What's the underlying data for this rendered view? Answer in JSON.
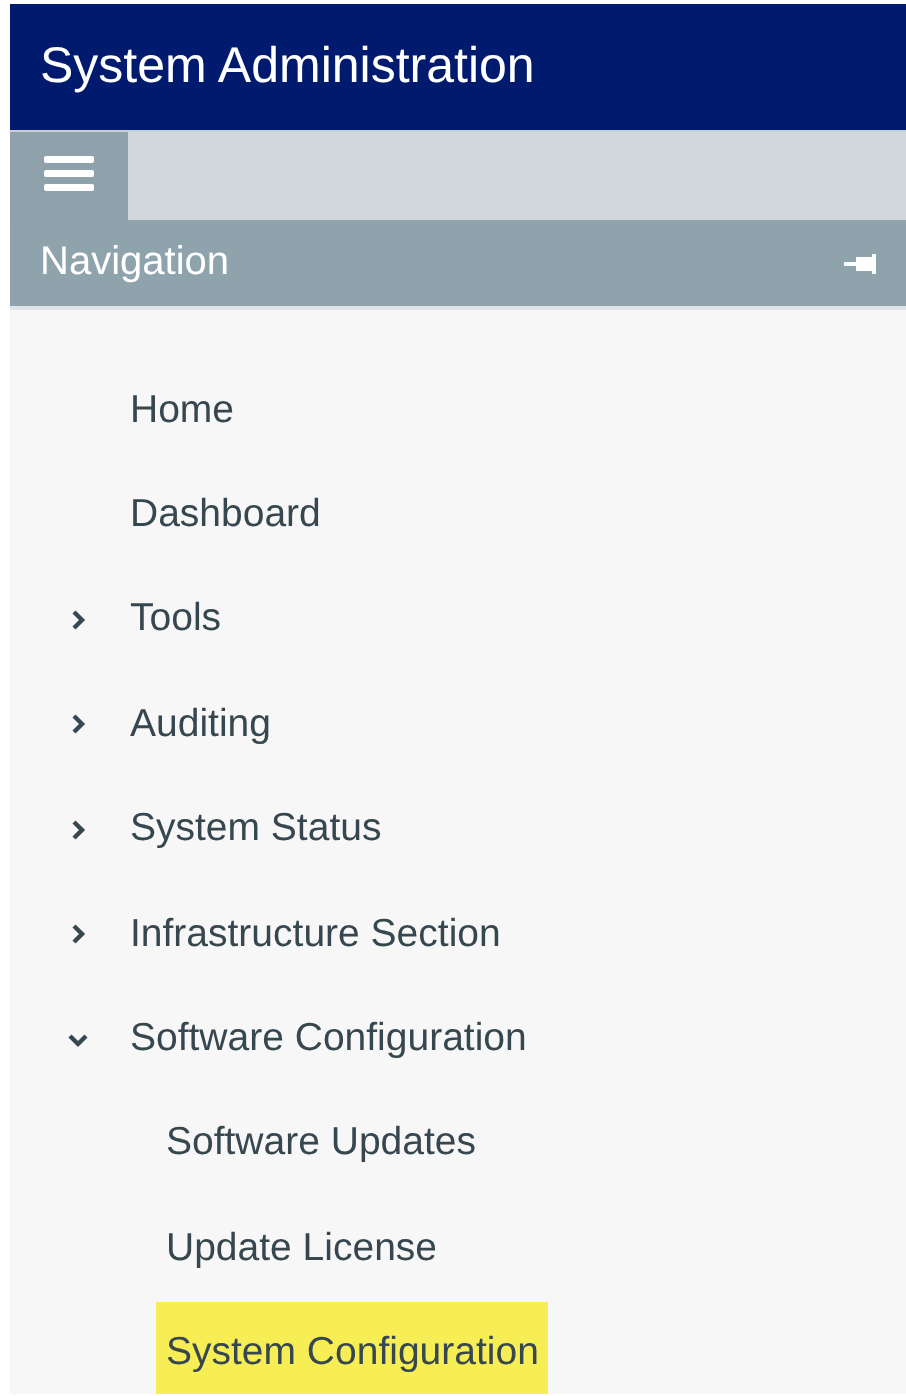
{
  "window": {
    "title": "System Administration"
  },
  "navigation": {
    "title": "Navigation",
    "items": [
      {
        "label": "Home",
        "selected": false
      },
      {
        "label": "Dashboard",
        "selected": false
      },
      {
        "label": "Tools",
        "selected": false,
        "expanded": false
      },
      {
        "label": "Auditing",
        "selected": false,
        "expanded": false
      },
      {
        "label": "System Status",
        "selected": false,
        "expanded": false
      },
      {
        "label": "Infrastructure Section",
        "selected": false,
        "expanded": false
      },
      {
        "label": "Software Configuration",
        "selected": false,
        "expanded": true,
        "children": [
          {
            "label": "Software Updates",
            "selected": false
          },
          {
            "label": "Update License",
            "selected": false
          },
          {
            "label": "System Configuration",
            "selected": true
          }
        ]
      }
    ]
  }
}
